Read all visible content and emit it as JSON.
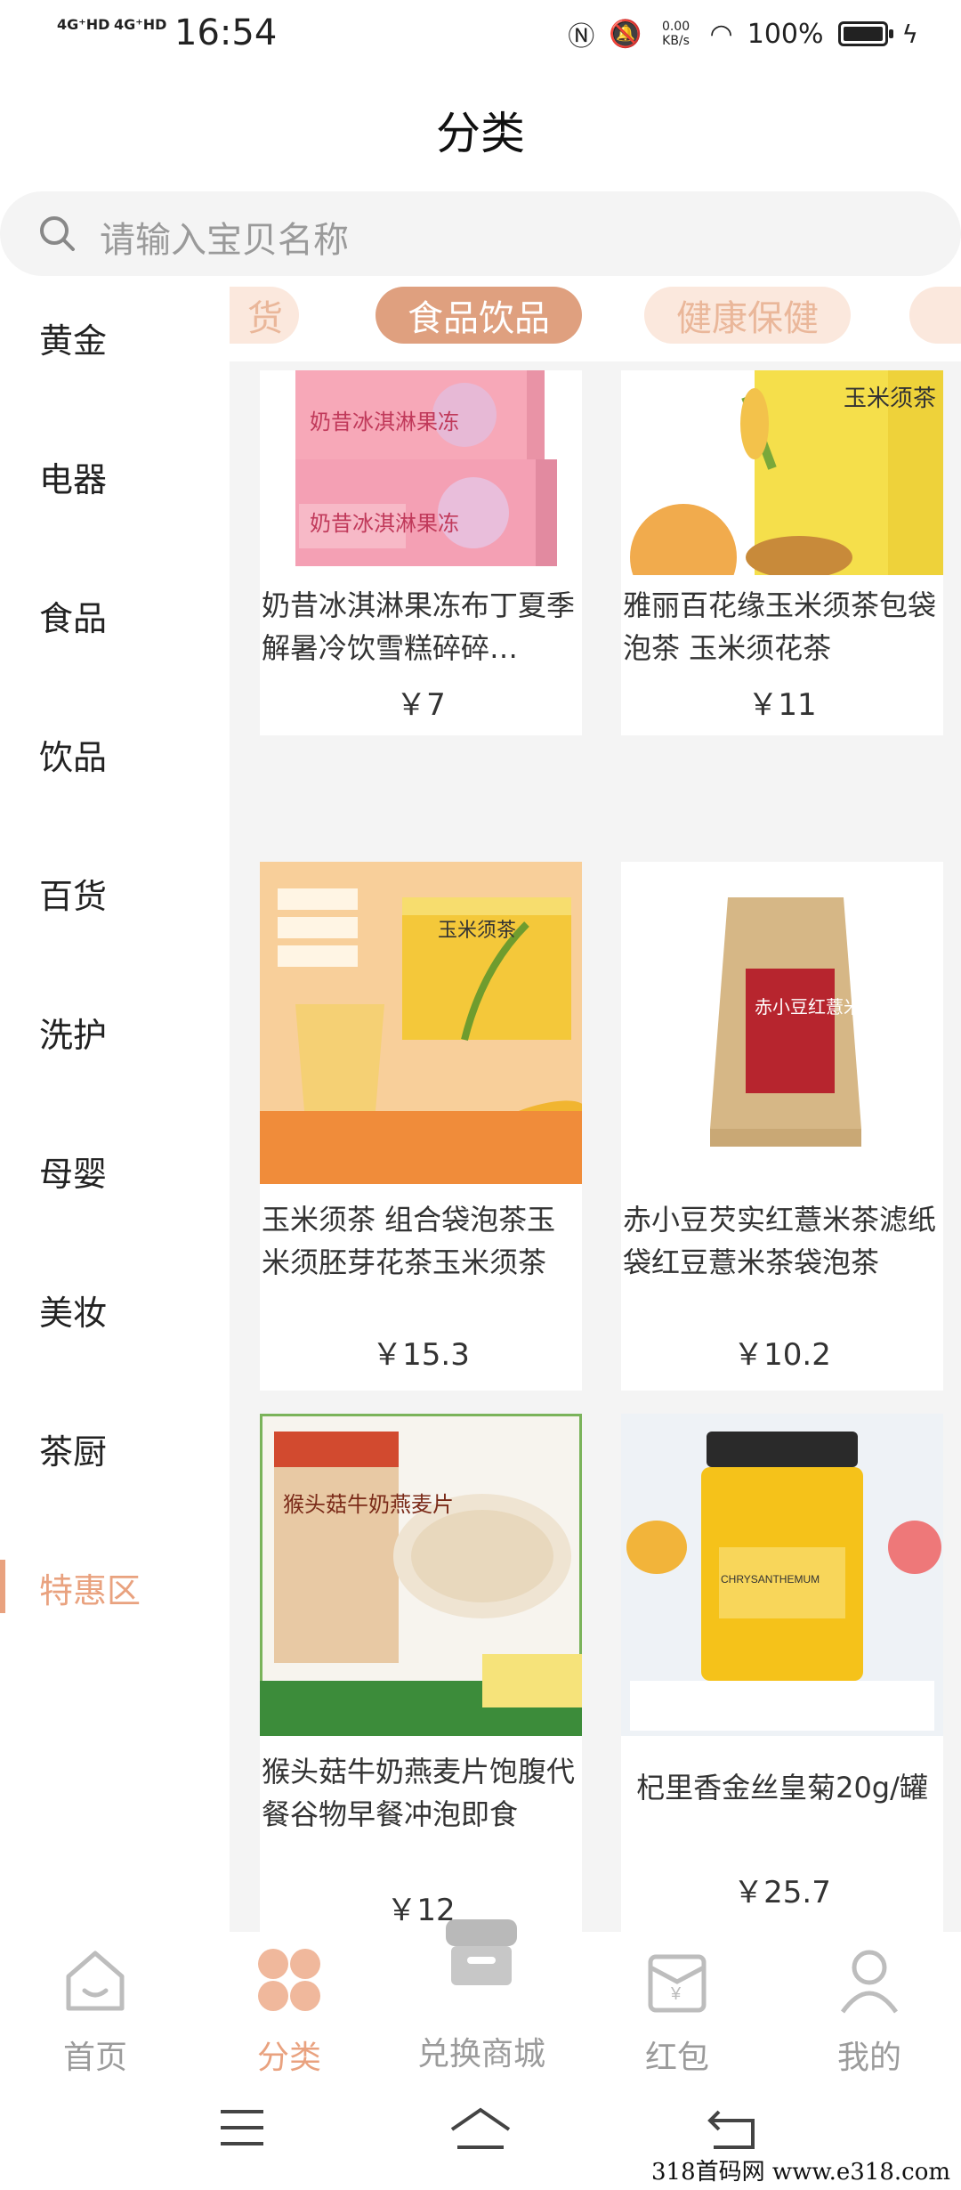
{
  "status_bar": {
    "signal_1": "4G⁺HD",
    "signal_2": "4G⁺HD",
    "time": "16:54",
    "net_speed": "0.00 KB/s",
    "battery": "100%"
  },
  "header": {
    "title": "分类"
  },
  "search": {
    "placeholder": "请输入宝贝名称"
  },
  "sidebar": {
    "items": [
      {
        "label": "黄金"
      },
      {
        "label": "电器"
      },
      {
        "label": "食品"
      },
      {
        "label": "饮品"
      },
      {
        "label": "百货"
      },
      {
        "label": "洗护"
      },
      {
        "label": "母婴"
      },
      {
        "label": "美妆"
      },
      {
        "label": "茶厨"
      },
      {
        "label": "特惠区"
      }
    ],
    "active_label": "特惠区"
  },
  "category_tabs": {
    "items": [
      {
        "label": "货"
      },
      {
        "label": "食品饮品"
      },
      {
        "label": "健康保健"
      }
    ],
    "active_label": "食品饮品"
  },
  "products": [
    {
      "title": "奶昔冰淇淋果冻布丁夏季解暑冷饮雪糕碎碎…",
      "price": "￥7",
      "image_text": "奶昔冰淇淋果冻"
    },
    {
      "title": "雅丽百花缘玉米须茶包袋泡茶 玉米须花茶",
      "price": "￥11",
      "image_text": "玉米须茶"
    },
    {
      "title": "玉米须茶 组合袋泡茶玉米须胚芽花茶玉米须茶",
      "price": "￥15.3",
      "image_text": "玉米须茶"
    },
    {
      "title": "赤小豆芡实红薏米茶滤纸袋红豆薏米茶袋泡茶",
      "price": "￥10.2",
      "image_text": "赤小豆红薏米芡实茶"
    },
    {
      "title": "猴头菇牛奶燕麦片饱腹代餐谷物早餐冲泡即食",
      "price": "￥12",
      "image_text": "猴头菇牛奶燕麦片"
    },
    {
      "title": "杞里香金丝皇菊20g/罐",
      "price": "￥25.7",
      "image_text": "CHRYSANTHEMUM"
    }
  ],
  "bottom_nav": {
    "items": [
      {
        "label": "首页"
      },
      {
        "label": "分类"
      },
      {
        "label": "兑换商城"
      },
      {
        "label": "红包"
      },
      {
        "label": "我的"
      }
    ],
    "active_label": "分类"
  },
  "watermark": "318首码网 www.e318.com",
  "colors": {
    "accent": "#e9a27f",
    "tab_active_bg": "#dfa07f",
    "tab_inactive_bg": "#fbe8dd",
    "content_bg": "#f4f4f4"
  }
}
